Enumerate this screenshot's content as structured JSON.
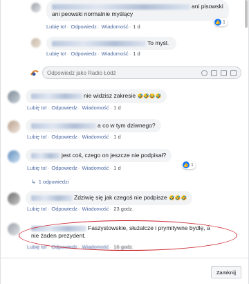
{
  "comments": [
    {
      "text": "ani pisowski",
      "text2": "ani peowski normalnie myślący"
    },
    {
      "text": "To myśl."
    },
    {
      "text": "nie widzisz zakresie",
      "emoji": "🤣🤣😂🤣"
    },
    {
      "text": "a co w tym dziwnego?"
    },
    {
      "text": "jest coś, czego on jeszcze nie podpisał?"
    },
    {
      "text": "Zdziwię się jak czegoś nie podpisze",
      "emoji": "🤣🤣🤣"
    },
    {
      "text": "Faszystowskie, służalcze i prymitywne bydlę, a",
      "text2": "nie żaden prezydent."
    }
  ],
  "actions": {
    "like": "Lubię to!",
    "reply": "Odpowiedz",
    "message": "Wiadomość",
    "sep": "·",
    "time_1d": "1 d",
    "time_23": "23 godz.",
    "time_16": "16 godz."
  },
  "reactions": {
    "count1": "1"
  },
  "reply_box": {
    "placeholder": "Odpowiedz jako Radio Łódź"
  },
  "more_replies": {
    "label": "1 odpowiedzi",
    "arrow": "↳"
  },
  "footer": {
    "close_label": "Zamknij"
  },
  "icons": [
    "smile-icon",
    "camera-icon",
    "gif-icon",
    "sticker-icon"
  ]
}
